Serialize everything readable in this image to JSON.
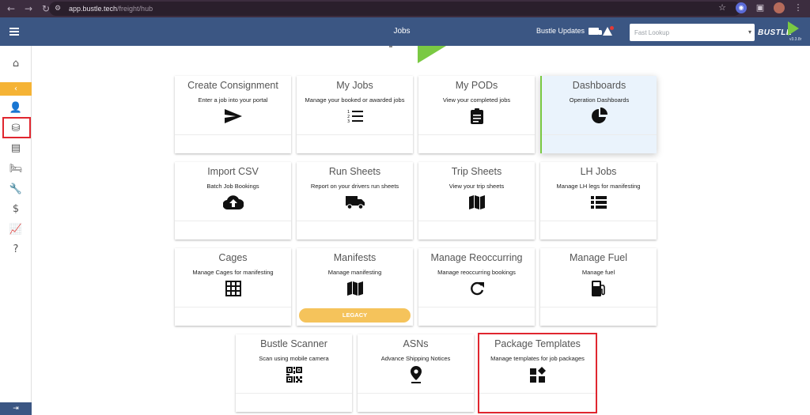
{
  "browser": {
    "url_host": "app.bustle.tech",
    "url_path": "/freight/hub"
  },
  "header": {
    "title": "Jobs",
    "updates_label": "Bustle Updates",
    "lookup_placeholder": "Fast Lookup",
    "logo_text": "BUSTLE",
    "version": "v3.3.8r"
  },
  "cards": {
    "create_consignment": {
      "title": "Create Consignment",
      "subtitle": "Enter a job into your portal",
      "icon": "send-icon"
    },
    "my_jobs": {
      "title": "My Jobs",
      "subtitle": "Manage your booked or awarded jobs",
      "icon": "ordered-list-icon"
    },
    "my_pods": {
      "title": "My PODs",
      "subtitle": "View your completed jobs",
      "icon": "clipboard-icon"
    },
    "dashboards": {
      "title": "Dashboards",
      "subtitle": "Operation Dashboards",
      "icon": "pie-chart-icon"
    },
    "import_csv": {
      "title": "Import CSV",
      "subtitle": "Batch Job Bookings",
      "icon": "cloud-upload-icon"
    },
    "run_sheets": {
      "title": "Run Sheets",
      "subtitle": "Report on your drivers run sheets",
      "icon": "truck-icon"
    },
    "trip_sheets": {
      "title": "Trip Sheets",
      "subtitle": "View your trip sheets",
      "icon": "map-icon"
    },
    "lh_jobs": {
      "title": "LH Jobs",
      "subtitle": "Manage LH legs for manifesting",
      "icon": "list-icon"
    },
    "cages": {
      "title": "Cages",
      "subtitle": "Manage Cages for manifesting",
      "icon": "grid-icon"
    },
    "manifests": {
      "title": "Manifests",
      "subtitle": "Manage manifesting",
      "icon": "map-icon",
      "legacy_label": "LEGACY"
    },
    "manage_reoccurring": {
      "title": "Manage Reoccurring",
      "subtitle": "Manage reoccurring bookings",
      "icon": "refresh-icon"
    },
    "manage_fuel": {
      "title": "Manage Fuel",
      "subtitle": "Manage fuel",
      "icon": "fuel-pump-icon"
    },
    "bustle_scanner": {
      "title": "Bustle Scanner",
      "subtitle": "Scan using mobile camera",
      "icon": "qr-code-icon"
    },
    "asns": {
      "title": "ASNs",
      "subtitle": "Advance Shipping Notices",
      "icon": "map-pin-icon"
    },
    "package_templates": {
      "title": "Package Templates",
      "subtitle": "Manage templates for job packages",
      "icon": "widgets-icon"
    }
  },
  "colors": {
    "header_bg": "#3b5683",
    "accent_green": "#7ac943",
    "collapse_orange": "#f5b335",
    "highlight_red": "#e0262f",
    "legacy_yellow": "#f5c35b"
  }
}
